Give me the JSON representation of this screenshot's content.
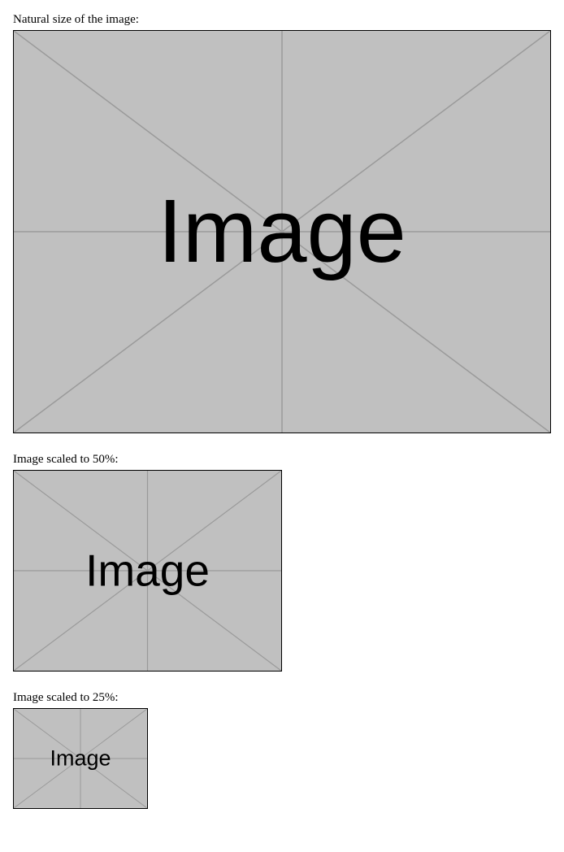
{
  "sections": [
    {
      "caption": "Natural size of the image:",
      "placeholder_text": "Image"
    },
    {
      "caption": "Image scaled to 50%:",
      "placeholder_text": "Image"
    },
    {
      "caption": "Image scaled to 25%:",
      "placeholder_text": "Image"
    }
  ]
}
